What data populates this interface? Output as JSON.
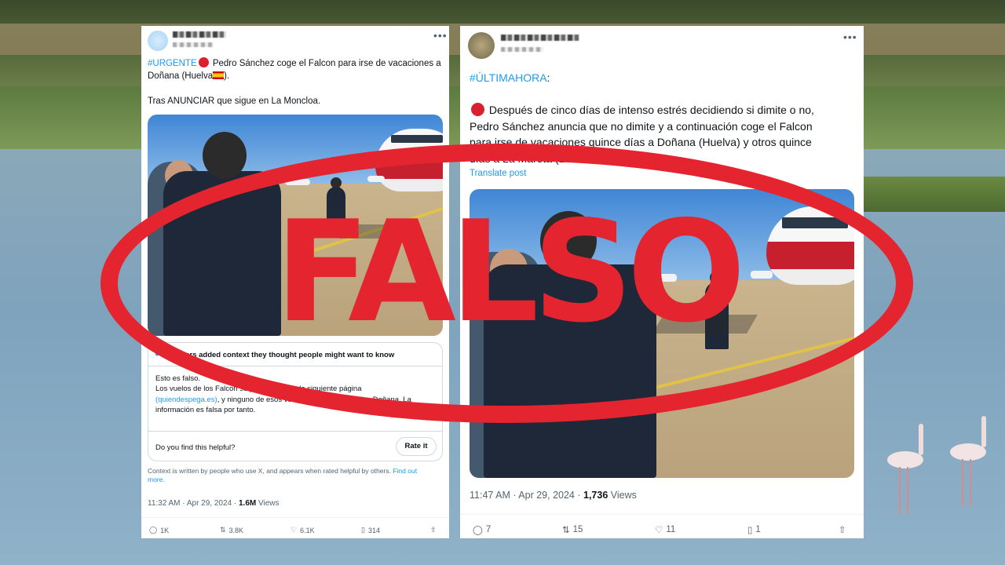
{
  "stamp": {
    "text": "FALSO",
    "color": "#e4252f"
  },
  "left_post": {
    "hashtag": "#URGENTE",
    "line1": " Pedro Sánchez coge el Falcon para irse de vacaciones a",
    "line2": "Doñana (Huelva",
    "line2_end": ").",
    "line3": "Tras ANUNCIAR que sigue en La Moncloa.",
    "context": {
      "header": "Readers added context they thought people might want to know",
      "line1": "Esto es falso.",
      "line2": "Los vuelos de los Falcon se pueden ver en la siguiente página",
      "line3_link": "(quiendespega.es)",
      "line3_rest": ", y ninguno de esos vuelos tenía como destino Doñana. La",
      "line4": "información es falsa por tanto.",
      "question": "Do you find this helpful?",
      "rate_button": "Rate it",
      "footnote": "Context is written by people who use X, and appears when rated helpful by others.",
      "footnote_link1": "Find out",
      "footnote_link2": "more."
    },
    "time": "11:32 AM · Apr 29, 2024 · ",
    "views_count": "1.6M",
    "views_label": " Views",
    "actions": {
      "replies": "1K",
      "reposts": "3.8K",
      "likes": "6.1K",
      "bookmarks": "314"
    }
  },
  "right_post": {
    "hashtag": "#ÚLTIMAHORA",
    "hashtag_suffix": ":",
    "line1": " Después de cinco días de intenso estrés decidiendo si dimite o no,",
    "line2": "Pedro Sánchez anuncia que no dimite y a continuación coge el Falcon",
    "line3": "para irse de vacaciones quince días a Doñana (Huelva) y otros quince",
    "line4": "días a La Mareta (Lanzarote).",
    "translate": "Translate post",
    "time": "11:47 AM · Apr 29, 2024 · ",
    "views_count": "1,736",
    "views_label": " Views",
    "actions": {
      "replies": "7",
      "reposts": "15",
      "likes": "11",
      "bookmarks": "1"
    }
  },
  "icons": {
    "more": "more-icon",
    "reply": "reply-icon",
    "repost": "repost-icon",
    "like": "heart-icon",
    "bookmark": "bookmark-icon",
    "share": "share-icon",
    "community_notes": "people-icon"
  }
}
